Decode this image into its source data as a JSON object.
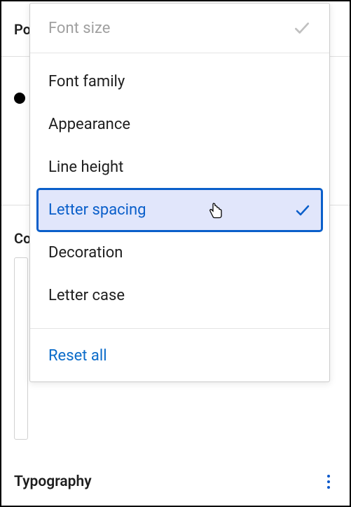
{
  "bg": {
    "label_top": "Po",
    "label_mid": "Co"
  },
  "bottom": {
    "label": "Typography"
  },
  "popover": {
    "header_label": "Font size",
    "options": [
      {
        "label": "Font family"
      },
      {
        "label": "Appearance"
      },
      {
        "label": "Line height"
      },
      {
        "label": "Letter spacing"
      },
      {
        "label": "Decoration"
      },
      {
        "label": "Letter case"
      }
    ],
    "reset_label": "Reset all"
  }
}
